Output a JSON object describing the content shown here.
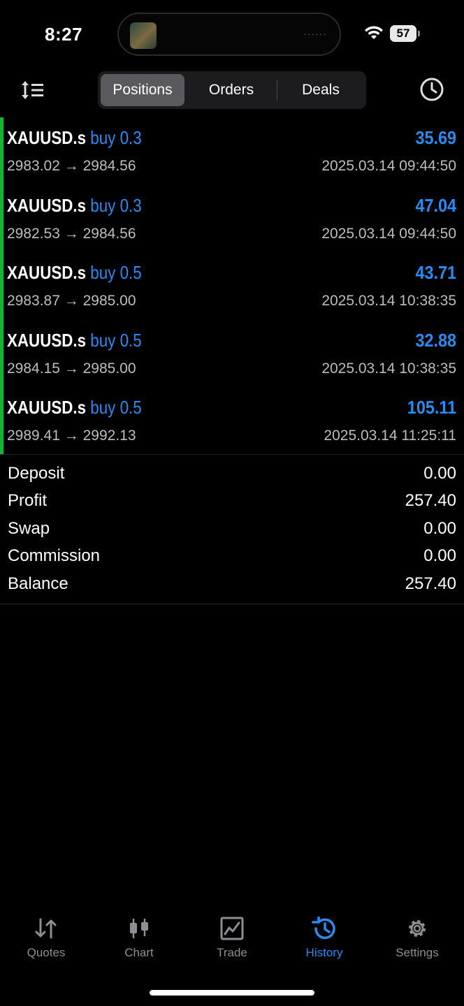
{
  "status": {
    "time": "8:27",
    "battery": "57",
    "island_dots": "······"
  },
  "segments": [
    {
      "label": "Positions",
      "active": true
    },
    {
      "label": "Orders",
      "active": false
    },
    {
      "label": "Deals",
      "active": false
    }
  ],
  "positions": [
    {
      "symbol": "XAUUSD.s",
      "direction": "buy",
      "volume": "0.3",
      "profit": "35.69",
      "open_price": "2983.02",
      "close_price": "2984.56",
      "time": "2025.03.14 09:44:50"
    },
    {
      "symbol": "XAUUSD.s",
      "direction": "buy",
      "volume": "0.3",
      "profit": "47.04",
      "open_price": "2982.53",
      "close_price": "2984.56",
      "time": "2025.03.14 09:44:50"
    },
    {
      "symbol": "XAUUSD.s",
      "direction": "buy",
      "volume": "0.5",
      "profit": "43.71",
      "open_price": "2983.87",
      "close_price": "2985.00",
      "time": "2025.03.14 10:38:35"
    },
    {
      "symbol": "XAUUSD.s",
      "direction": "buy",
      "volume": "0.5",
      "profit": "32.88",
      "open_price": "2984.15",
      "close_price": "2985.00",
      "time": "2025.03.14 10:38:35"
    },
    {
      "symbol": "XAUUSD.s",
      "direction": "buy",
      "volume": "0.5",
      "profit": "105.11",
      "open_price": "2989.41",
      "close_price": "2992.13",
      "time": "2025.03.14 11:25:11"
    }
  ],
  "arrow": "→",
  "summary": [
    {
      "label": "Deposit",
      "value": "0.00"
    },
    {
      "label": "Profit",
      "value": "257.40"
    },
    {
      "label": "Swap",
      "value": "0.00"
    },
    {
      "label": "Commission",
      "value": "0.00"
    },
    {
      "label": "Balance",
      "value": "257.40"
    }
  ],
  "tabs": [
    {
      "label": "Quotes",
      "icon": "quotes-icon",
      "active": false
    },
    {
      "label": "Chart",
      "icon": "chart-icon",
      "active": false
    },
    {
      "label": "Trade",
      "icon": "trade-icon",
      "active": false
    },
    {
      "label": "History",
      "icon": "history-icon",
      "active": true
    },
    {
      "label": "Settings",
      "icon": "settings-icon",
      "active": false
    }
  ],
  "colors": {
    "accent": "#2a8cf0",
    "positive_bar": "#17b52f",
    "secondary_text": "#bdbdbd",
    "tab_inactive": "#8e8e93"
  }
}
